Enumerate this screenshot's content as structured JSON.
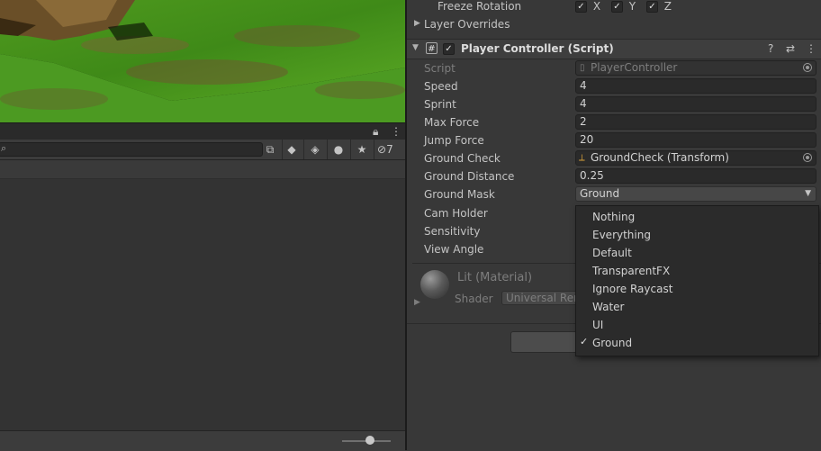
{
  "project": {
    "hidden_count": "7"
  },
  "inspector": {
    "freeze_rotation": {
      "label": "Freeze Rotation",
      "axes": [
        "X",
        "Y",
        "Z"
      ]
    },
    "layer_overrides_label": "Layer Overrides",
    "component": {
      "title": "Player Controller (Script)",
      "enabled": true
    },
    "fields": [
      {
        "label": "Script",
        "value": "PlayerController"
      },
      {
        "label": "Speed",
        "value": "4"
      },
      {
        "label": "Sprint",
        "value": "4"
      },
      {
        "label": "Max Force",
        "value": "2"
      },
      {
        "label": "Jump Force",
        "value": "20"
      },
      {
        "label": "Ground Check",
        "value": "GroundCheck (Transform)"
      },
      {
        "label": "Ground Distance",
        "value": "0.25"
      },
      {
        "label": "Ground Mask",
        "value": "Ground"
      },
      {
        "label": "Cam Holder",
        "value": ""
      },
      {
        "label": "Sensitivity",
        "value": ""
      },
      {
        "label": "View Angle",
        "value": ""
      }
    ],
    "material": {
      "name": "Lit (Material)",
      "shader_label": "Shader",
      "shader_value": "Universal Render Pipeline/Lit"
    }
  },
  "layer_dropdown": {
    "options": [
      "Nothing",
      "Everything",
      "Default",
      "TransparentFX",
      "Ignore Raycast",
      "Water",
      "UI",
      "Ground"
    ],
    "selected": "Ground",
    "check_glyph": "✓"
  }
}
